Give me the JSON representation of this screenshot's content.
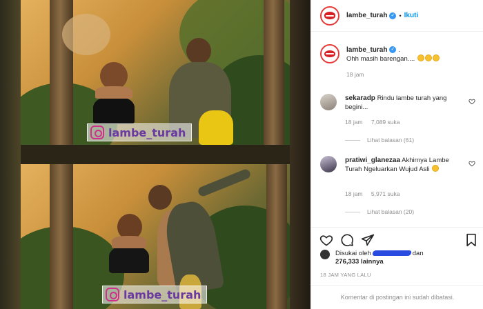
{
  "post": {
    "username": "lambe_turah",
    "dot": "•",
    "follow_label": "Ikuti"
  },
  "caption": {
    "username": "lambe_turah",
    "suffix": ".",
    "text": "Ohh masih barengan....",
    "time": "18 jam"
  },
  "watermark": {
    "text_top": "lambe_turah",
    "text_bottom": "lambe_turah"
  },
  "comments": [
    {
      "username": "sekaradp",
      "text": "Rindu lambe turah yang begini...",
      "time": "18 jam",
      "likes": "7,089 suka",
      "replies": "Lihat balasan (61)"
    },
    {
      "username": "pratiwi_glanezaa",
      "text": "Akhirnya Lambe Turah Ngeluarkan Wujud Asli",
      "time": "18 jam",
      "likes": "5,971 suka",
      "replies": "Lihat balasan (20)"
    }
  ],
  "likes": {
    "prefix": "Disukai oleh",
    "middle": "dan",
    "count": "276,333 lainnya"
  },
  "timestamp": "18 JAM YANG LALU",
  "restricted_text": "Komentar di postingan ini sudah dibatasi.",
  "colors": {
    "accent": "#0095f6",
    "verified": "#3897f0",
    "brand_red": "#d81f26",
    "meta_gray": "#8e8e8e"
  },
  "icons": [
    "lips-avatar",
    "verified-badge",
    "heart-icon",
    "comment-icon",
    "share-icon",
    "bookmark-icon",
    "instagram-logo-icon"
  ]
}
